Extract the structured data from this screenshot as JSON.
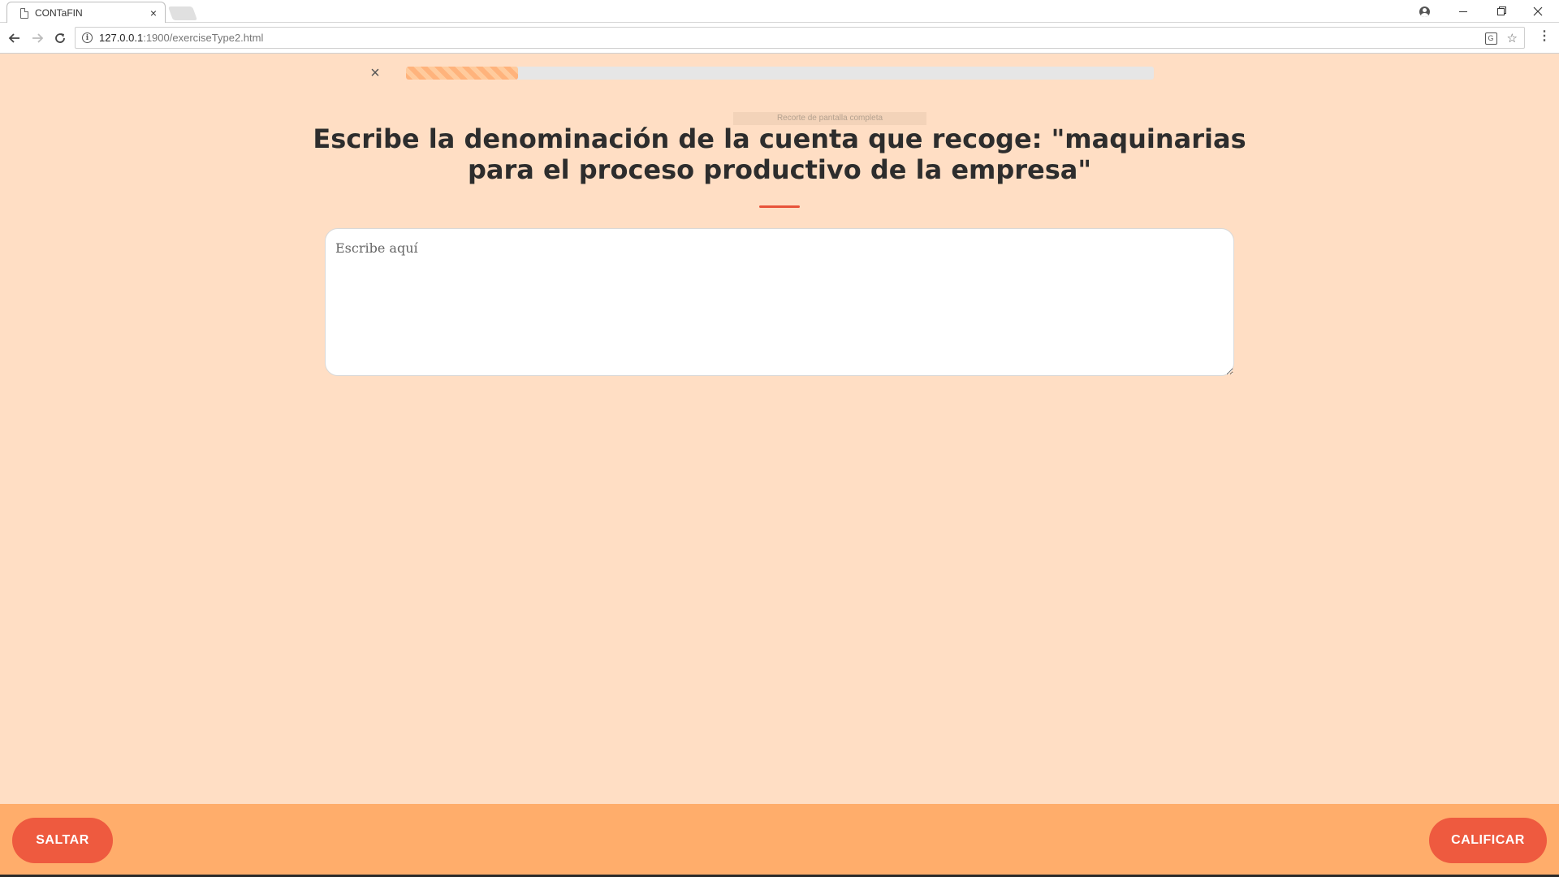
{
  "browser": {
    "tab_title": "CONTaFIN",
    "tab_close": "×",
    "url_host": "127.0.0.1",
    "url_path": ":1900/exerciseType2.html"
  },
  "exercise": {
    "close_symbol": "×",
    "progress_fraction": 0.15,
    "snip_hint": "Recorte de pantalla completa",
    "question": "Escribe la denominación de la cuenta que recoge: \"maquinarias para el proceso productivo de la empresa\"",
    "answer_placeholder": "Escribe aquí",
    "answer_value": ""
  },
  "footer": {
    "skip_label": "SALTAR",
    "grade_label": "CALIFICAR"
  },
  "colors": {
    "page_background": "#ffdec4",
    "footer_background": "#ffad6b",
    "accent": "#ee5a3f",
    "progress_fill": "#ffb37c"
  },
  "icons": [
    "document-icon",
    "profile-icon",
    "back-arrow-icon",
    "forward-arrow-icon",
    "reload-icon",
    "info-icon",
    "translate-icon",
    "star-icon",
    "menu-icon",
    "close-icon"
  ]
}
